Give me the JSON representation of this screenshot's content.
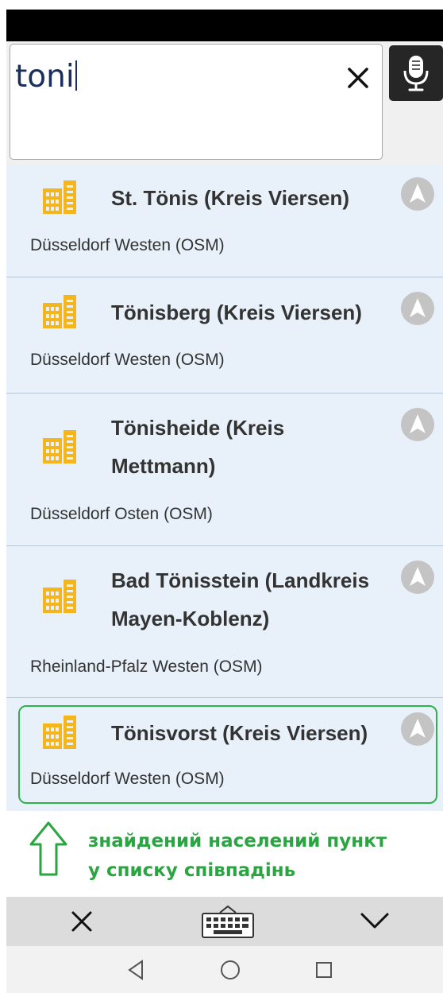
{
  "search": {
    "query": "toni"
  },
  "results": [
    {
      "title": "St. Tönis (Kreis Viersen)",
      "subtitle": "Düsseldorf Westen (OSM)"
    },
    {
      "title": "Tönisberg (Kreis Viersen)",
      "subtitle": "Düsseldorf Westen (OSM)"
    },
    {
      "title": "Tönisheide (Kreis Mettmann)",
      "subtitle": "Düsseldorf Osten (OSM)"
    },
    {
      "title": "Bad Tönisstein (Landkreis Mayen-Koblenz)",
      "subtitle": "Rheinland-Pfalz Westen (OSM)"
    },
    {
      "title": "Tönisvorst (Kreis Viersen)",
      "subtitle": "Düsseldorf Westen (OSM)"
    }
  ],
  "annotation": {
    "line1": "знайдений населений пункт",
    "line2": "у списку співпадінь"
  },
  "colors": {
    "list_background": "#e8f1f9",
    "building_icon": "#f5b51c",
    "annotation_green": "#2aa542",
    "nav_icon": "#c4c4c4",
    "search_text": "#1b2f5c"
  },
  "icons": {
    "result": "building-icon",
    "result_action": "navigate-arrow-icon",
    "search_clear": "close-icon",
    "voice": "microphone-icon",
    "annotation": "up-arrow-icon",
    "keyboard_bar": [
      "close-icon",
      "keyboard-icon",
      "chevron-down-icon"
    ],
    "system_nav": [
      "back-icon",
      "home-icon",
      "recents-icon"
    ]
  }
}
